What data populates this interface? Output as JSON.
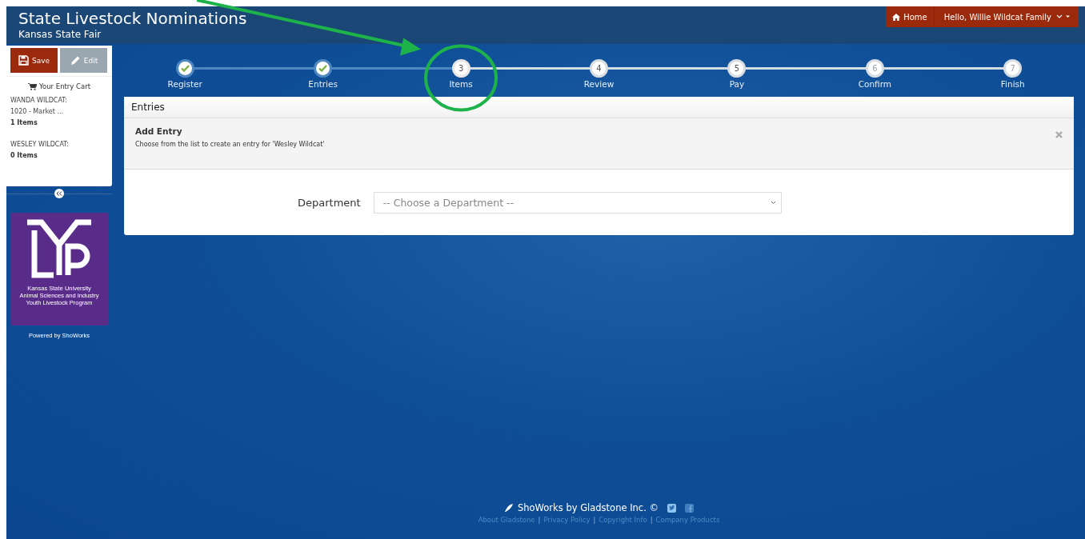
{
  "header": {
    "title": "State Livestock Nominations",
    "subtitle": "Kansas State Fair",
    "home": "Home",
    "user_menu": "Hello, Willie Wildcat Family"
  },
  "sidebar": {
    "save": "Save",
    "edit": "Edit",
    "edit_disabled": true,
    "cart_title": "Your Entry Cart",
    "cart": [
      {
        "name": "WANDA WILDCAT:",
        "entries": [
          "1020 - Market ..."
        ],
        "count": "1 Items"
      },
      {
        "name": "WESLEY WILDCAT:",
        "count": "0 Items"
      }
    ],
    "logo_caption": [
      "Kansas State University",
      "Animal Sciences and Industry",
      "Youth Livestock Program"
    ],
    "powered_by": "Powered by ShoWorks"
  },
  "steps": [
    {
      "label": "Register",
      "kind": "done"
    },
    {
      "label": "Entries",
      "kind": "done"
    },
    {
      "number": "3",
      "label": "Items",
      "kind": "current"
    },
    {
      "number": "4",
      "label": "Review",
      "kind": "upcoming"
    },
    {
      "number": "5",
      "label": "Pay",
      "kind": "upcoming"
    },
    {
      "number": "6",
      "label": "Confirm",
      "kind": "disabled"
    },
    {
      "number": "7",
      "label": "Finish",
      "kind": "disabled"
    }
  ],
  "panel": {
    "title": "Entries",
    "alert_title": "Add Entry",
    "alert_text": "Choose from the list to create an entry for 'Wesley Wildcat'",
    "field_label": "Department",
    "field_placeholder": "-- Choose a Department --"
  },
  "footer": {
    "brand": "ShoWorks by Gladstone Inc. ©",
    "links": [
      "About Gladstone",
      "Privacy Policy",
      "Copyright Info",
      "Company Products"
    ],
    "separators": [
      "|",
      "|",
      "|"
    ]
  }
}
